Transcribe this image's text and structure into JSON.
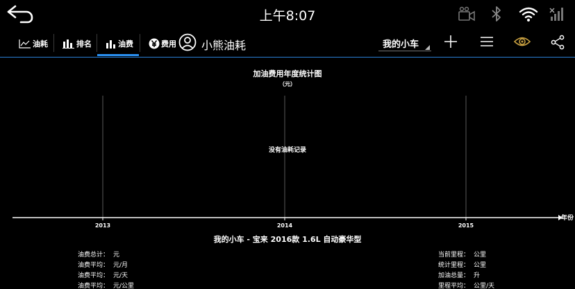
{
  "status_bar": {
    "time": "上午8:07",
    "icons": [
      "back-arrow-icon",
      "camera-off-icon",
      "bluetooth-icon",
      "wifi-icon",
      "no-signal-icon"
    ]
  },
  "toolbar": {
    "tabs": [
      {
        "label": "油耗",
        "icon": "line-chart-icon"
      },
      {
        "label": "排名",
        "icon": "ranking-icon"
      },
      {
        "label": "油费",
        "icon": "bar-chart-icon"
      },
      {
        "label": "费用",
        "icon": "yen-icon"
      }
    ],
    "active_tab": "油费",
    "app_title": "小熊油耗",
    "car_select": "我的小车",
    "icons": [
      "user-icon",
      "plus-icon",
      "menu-icon",
      "eye-icon",
      "share-icon"
    ],
    "accent_color": "#2a8ff0",
    "eye_color": "#c8a040"
  },
  "chart": {
    "title": "加油费用年度统计图",
    "unit": "（元）",
    "empty_message": "没有油耗记录",
    "x_axis_unit": "年份",
    "car_description": "我的小车 - 宝来 2016款 1.6L 自动豪华型"
  },
  "chart_data": {
    "type": "bar",
    "title": "加油费用年度统计图",
    "ylabel": "（元）",
    "xlabel": "年份",
    "categories": [
      "2013",
      "2014",
      "2015"
    ],
    "values": [],
    "grid": "vertical"
  },
  "stats": {
    "left": [
      {
        "label": "油费总计：",
        "unit": "元"
      },
      {
        "label": "油费平均：",
        "unit": "元/月"
      },
      {
        "label": "油费平均：",
        "unit": "元/天"
      },
      {
        "label": "油费平均：",
        "unit": "元/公里"
      }
    ],
    "right": [
      {
        "label": "当前里程：",
        "unit": "公里"
      },
      {
        "label": "统计里程：",
        "unit": "公里"
      },
      {
        "label": "加油总量：",
        "unit": "升"
      },
      {
        "label": "里程平均：",
        "unit": "公里/天"
      }
    ]
  }
}
